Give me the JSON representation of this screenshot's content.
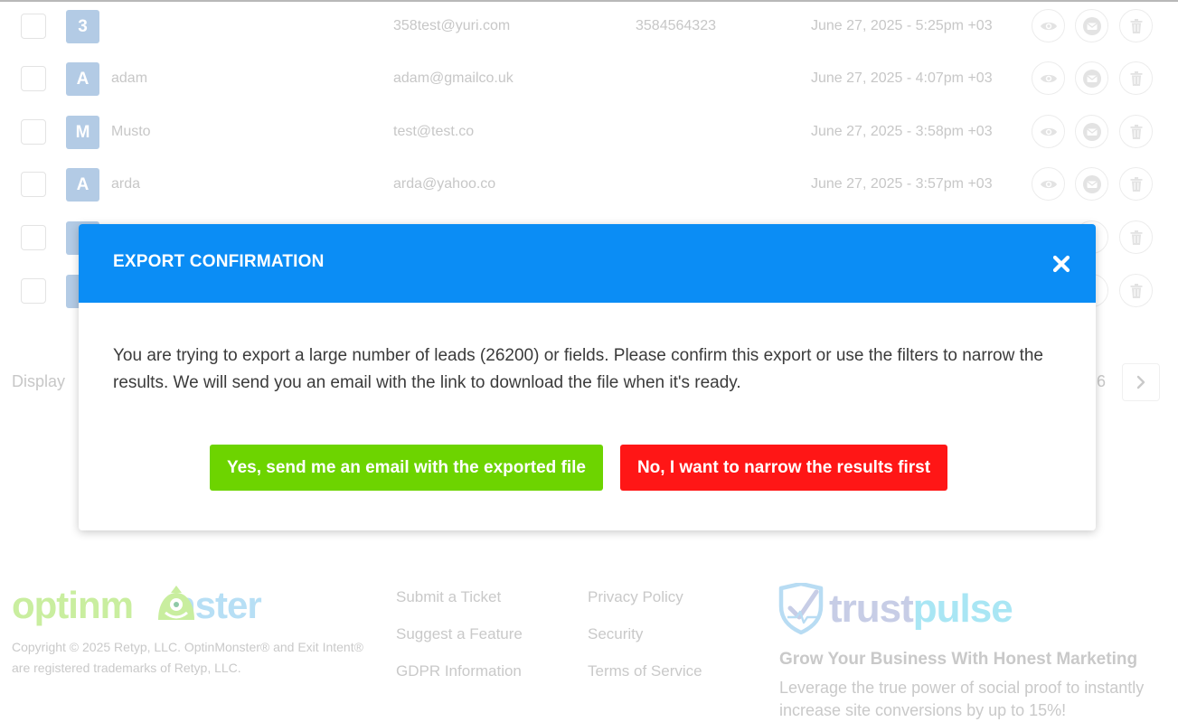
{
  "leads": [
    {
      "avatar": "3",
      "name": "",
      "email": "358test@yuri.com",
      "phone": "3584564323",
      "date": "June 27, 2025 - 5:25pm +03"
    },
    {
      "avatar": "A",
      "name": "adam",
      "email": "adam@gmailco.uk",
      "phone": "",
      "date": "June 27, 2025 - 4:07pm +03"
    },
    {
      "avatar": "M",
      "name": "Musto",
      "email": "test@test.co",
      "phone": "",
      "date": "June 27, 2025 - 3:58pm +03"
    },
    {
      "avatar": "A",
      "name": "arda",
      "email": "arda@yahoo.co",
      "phone": "",
      "date": "June 27, 2025 - 3:57pm +03"
    }
  ],
  "pagination": {
    "display_label": "Display",
    "last_page_fragment": "6"
  },
  "modal": {
    "title": "EXPORT CONFIRMATION",
    "message": "You are trying to export a large number of leads (26200) or fields. Please confirm this export or use the filters to narrow the results. We will send you an email with the link to download the file when it's ready.",
    "confirm_label": "Yes, send me an email with the exported file",
    "cancel_label": "No, I want to narrow the results first",
    "header_color": "#0b8df5",
    "confirm_color": "#6dd400",
    "cancel_color": "#ff1616"
  },
  "footer": {
    "logo_text_a": "optinm",
    "logo_text_b": "nster",
    "copyright": "Copyright © 2025 Retyp, LLC. OptinMonster® and Exit Intent® are registered trademarks of Retyp, LLC.",
    "links_col1": [
      "Submit a Ticket",
      "Suggest a Feature",
      "GDPR Information"
    ],
    "links_col2": [
      "Privacy Policy",
      "Security",
      "Terms of Service"
    ],
    "trustpulse": {
      "logo_a": "trust",
      "logo_b": "pulse",
      "headline": "Grow Your Business With Honest Marketing",
      "body": "Leverage the true power of social proof to instantly increase site conversions by up to 15%!"
    }
  },
  "icons": {
    "view": "eye-icon",
    "email": "envelope-icon",
    "delete": "trash-icon",
    "next": "chevron-right-icon",
    "close": "close-icon"
  }
}
